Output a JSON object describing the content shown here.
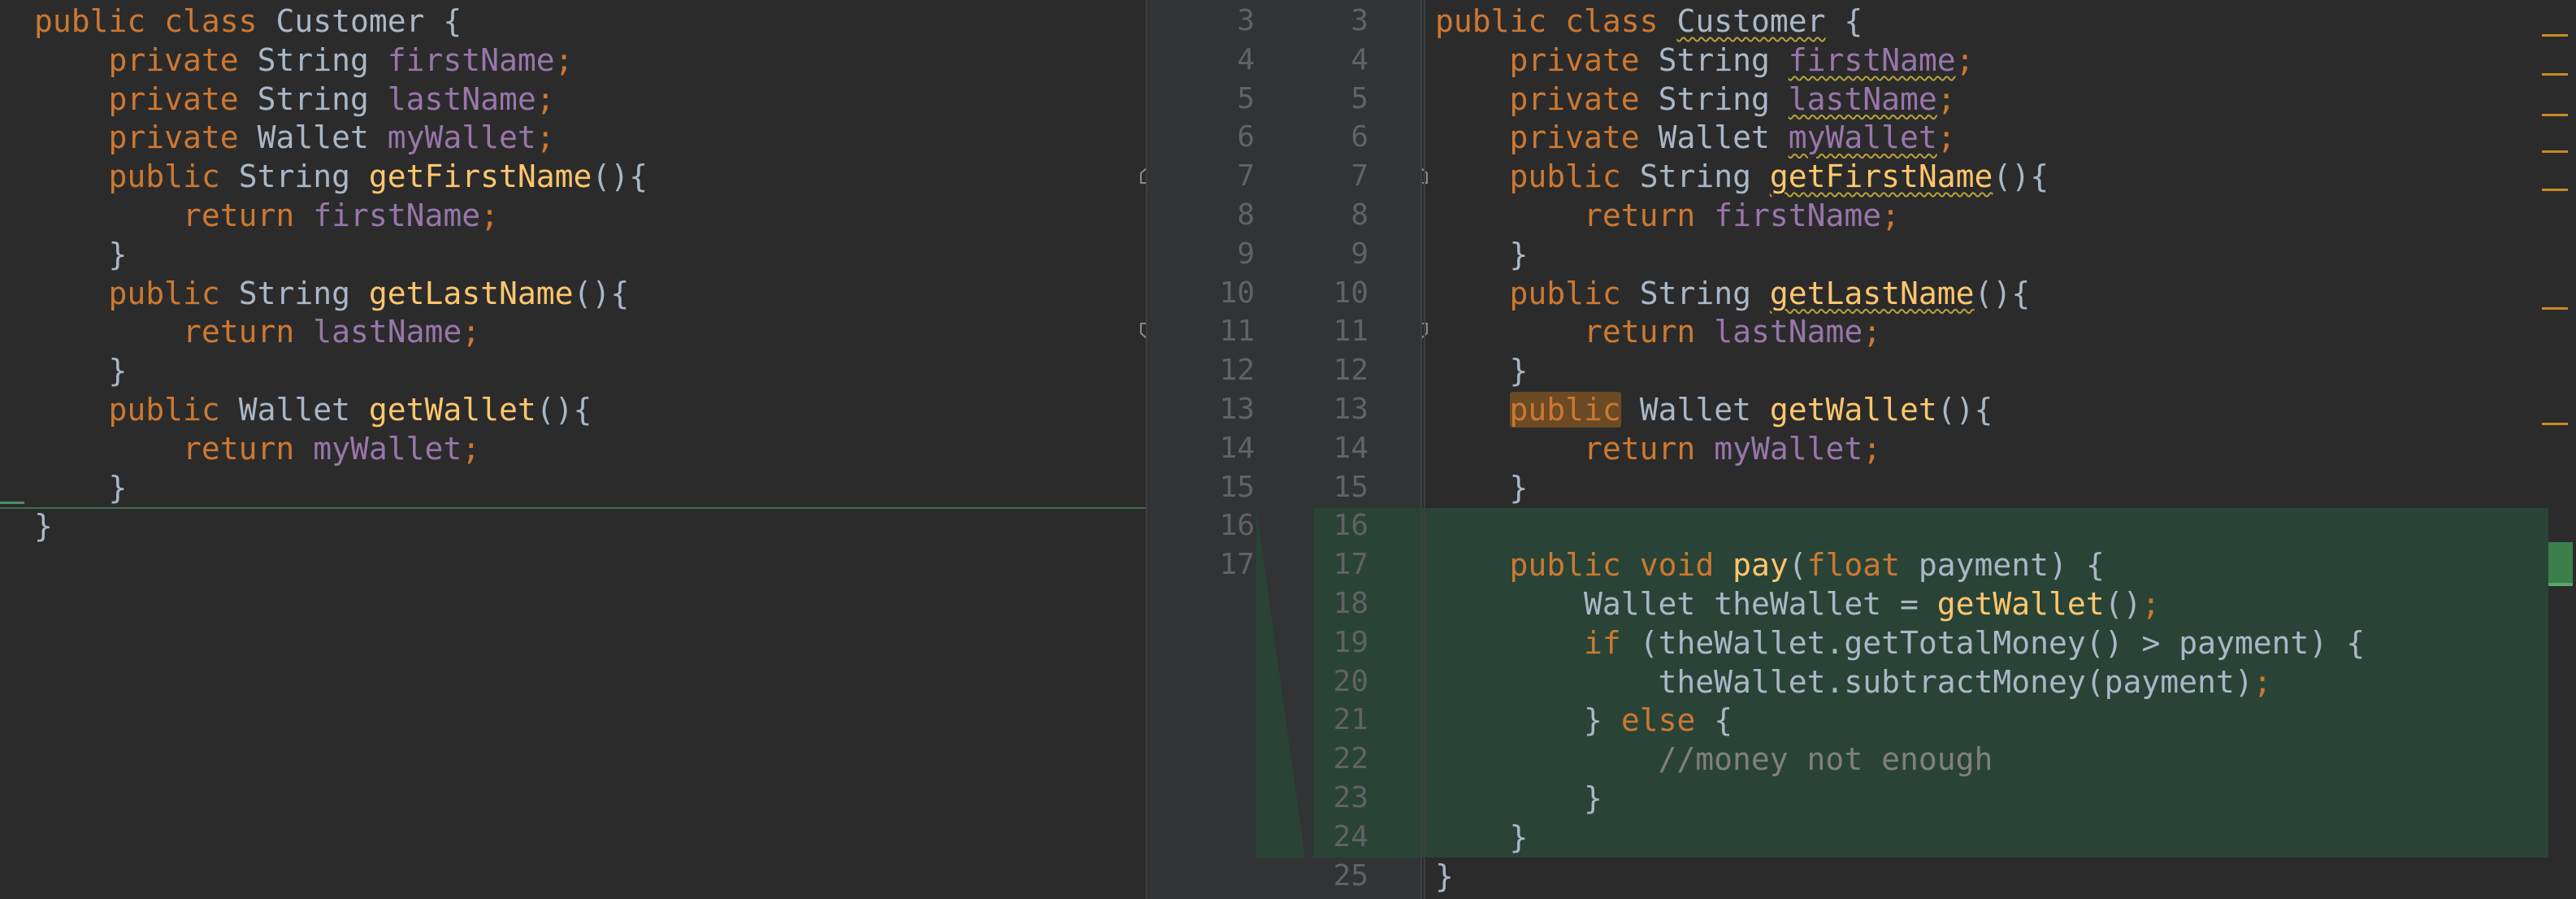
{
  "left": {
    "lines": [
      [
        "public class ",
        "Customer {"
      ],
      [
        "    private ",
        "String ",
        "firstName",
        ";"
      ],
      [
        "    private ",
        "String ",
        "lastName",
        ";"
      ],
      [
        "    private ",
        "Wallet ",
        "myWallet",
        ";"
      ],
      [
        "    public ",
        "String ",
        "getFirstName",
        "(){"
      ],
      [
        "        return ",
        "firstName",
        ";"
      ],
      [
        "    }"
      ],
      [
        "    public ",
        "String ",
        "getLastName",
        "(){"
      ],
      [
        "        return ",
        "lastName",
        ";"
      ],
      [
        "    }"
      ],
      [
        "    public ",
        "Wallet ",
        "getWallet",
        "(){"
      ],
      [
        "        return ",
        "myWallet",
        ";"
      ],
      [
        "    }"
      ],
      [
        "}"
      ]
    ]
  },
  "gutter": {
    "left_numbers": [
      "3",
      "4",
      "5",
      "6",
      "7",
      "8",
      "9",
      "10",
      "11",
      "12",
      "13",
      "14",
      "15",
      "16",
      "17"
    ],
    "right_numbers": [
      "3",
      "4",
      "5",
      "6",
      "7",
      "8",
      "9",
      "10",
      "11",
      "12",
      "13",
      "14",
      "15",
      "16",
      "17",
      "18",
      "19",
      "20",
      "21",
      "22",
      "23",
      "24",
      "25"
    ],
    "merge_arrow": "»"
  },
  "right": {
    "lines": [
      "public class Customer {",
      "    private String firstName;",
      "    private String lastName;",
      "    private Wallet myWallet;",
      "    public String getFirstName(){",
      "        return firstName;",
      "    }",
      "    public String getLastName(){",
      "        return lastName;",
      "    }",
      "    public Wallet getWallet(){",
      "        return myWallet;",
      "    }",
      "",
      "    public void pay(float payment) {",
      "        Wallet theWallet = getWallet();",
      "        if (theWallet.getTotalMoney() > payment) {",
      "            theWallet.subtractMoney(payment);",
      "        } else {",
      "            //money not enough",
      "        }",
      "    }",
      "}"
    ]
  },
  "colors": {
    "background": "#2b2b2b",
    "keyword": "#cc7832",
    "field": "#9876aa",
    "method": "#ffc66d",
    "text": "#a9b7c6",
    "comment": "#808080",
    "added_block": "#294436",
    "highlight": "#6b4a24"
  }
}
